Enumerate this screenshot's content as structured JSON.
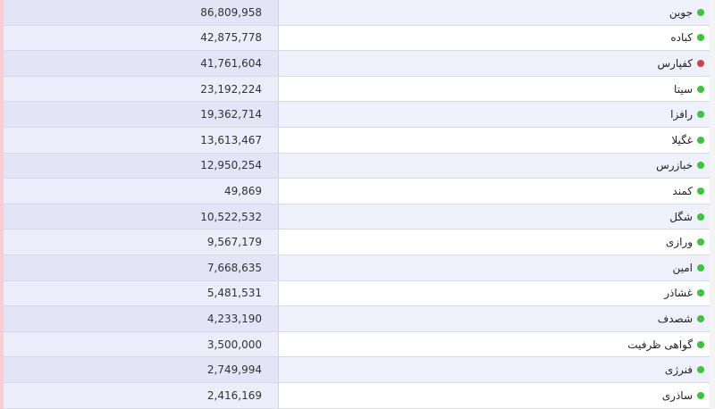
{
  "colors": {
    "status_green": "#3cc43c",
    "status_red": "#c94646"
  },
  "rows": [
    {
      "name": "جوین",
      "value": "86,809,958",
      "status_icon": "green-dot-icon",
      "status": "green"
    },
    {
      "name": "کباده",
      "value": "42,875,778",
      "status_icon": "green-dot-icon",
      "status": "green"
    },
    {
      "name": "کفپارس",
      "value": "41,761,604",
      "status_icon": "red-dot-icon",
      "status": "red"
    },
    {
      "name": "سیتا",
      "value": "23,192,224",
      "status_icon": "green-dot-icon",
      "status": "green"
    },
    {
      "name": "رافزا",
      "value": "19,362,714",
      "status_icon": "green-dot-icon",
      "status": "green"
    },
    {
      "name": "غگیلا",
      "value": "13,613,467",
      "status_icon": "green-dot-icon",
      "status": "green"
    },
    {
      "name": "خبازرس",
      "value": "12,950,254",
      "status_icon": "green-dot-icon",
      "status": "green"
    },
    {
      "name": "کمند",
      "value": "49,869",
      "status_icon": "green-dot-icon",
      "status": "green"
    },
    {
      "name": "شگل",
      "value": "10,522,532",
      "status_icon": "green-dot-icon",
      "status": "green"
    },
    {
      "name": "ورازی",
      "value": "9,567,179",
      "status_icon": "green-dot-icon",
      "status": "green"
    },
    {
      "name": "امین",
      "value": "7,668,635",
      "status_icon": "green-dot-icon",
      "status": "green"
    },
    {
      "name": "غشاذر",
      "value": "5,481,531",
      "status_icon": "green-dot-icon",
      "status": "green"
    },
    {
      "name": "شصدف",
      "value": "4,233,190",
      "status_icon": "green-dot-icon",
      "status": "green"
    },
    {
      "name": "گواهی ظرفیت",
      "value": "3,500,000",
      "status_icon": "green-dot-icon",
      "status": "green"
    },
    {
      "name": "فنرژی",
      "value": "2,749,994",
      "status_icon": "green-dot-icon",
      "status": "green"
    },
    {
      "name": "ساذری",
      "value": "2,416,169",
      "status_icon": "green-dot-icon",
      "status": "green"
    }
  ]
}
